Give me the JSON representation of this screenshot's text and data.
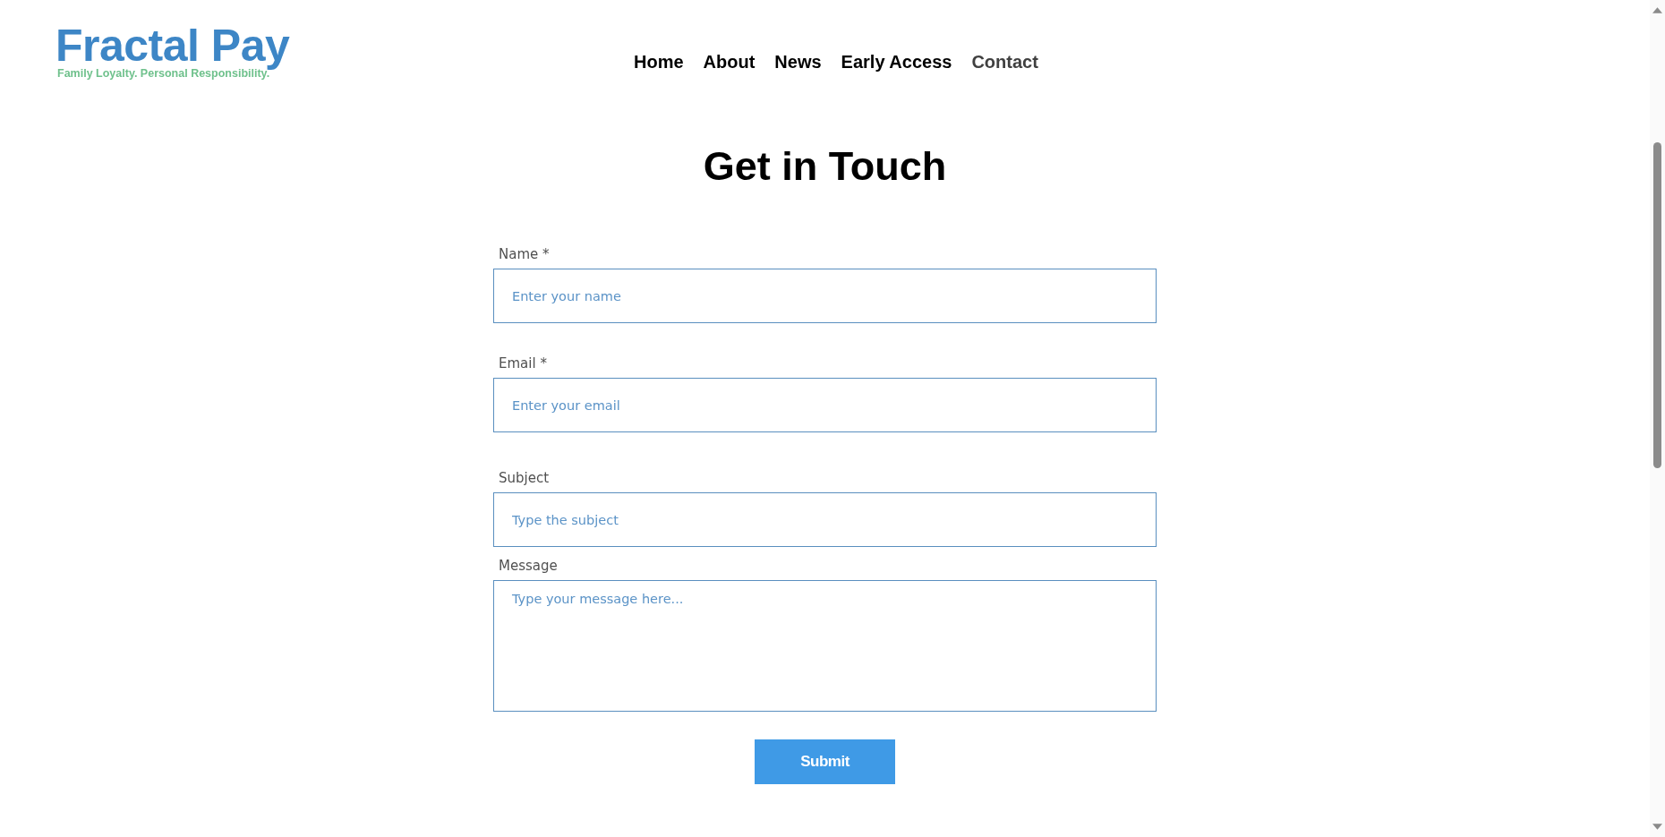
{
  "logo": {
    "name": "Fractal Pay",
    "tagline": "Family Loyalty. Personal Responsibility."
  },
  "nav": [
    {
      "label": "Home",
      "selected": false
    },
    {
      "label": "About",
      "selected": false
    },
    {
      "label": "News",
      "selected": false
    },
    {
      "label": "Early Access",
      "selected": false
    },
    {
      "label": "Contact",
      "selected": true
    }
  ],
  "heading": "Get in Touch",
  "form": {
    "fields": [
      {
        "label": "Name *",
        "placeholder": "Enter your name",
        "kind": "input"
      },
      {
        "label": "Email *",
        "placeholder": "Enter your email",
        "kind": "input"
      },
      {
        "label": "Subject",
        "placeholder": "Type the subject",
        "kind": "input"
      },
      {
        "label": "Message",
        "placeholder": "Type your message here...",
        "kind": "textarea"
      }
    ],
    "submit": "Submit"
  }
}
